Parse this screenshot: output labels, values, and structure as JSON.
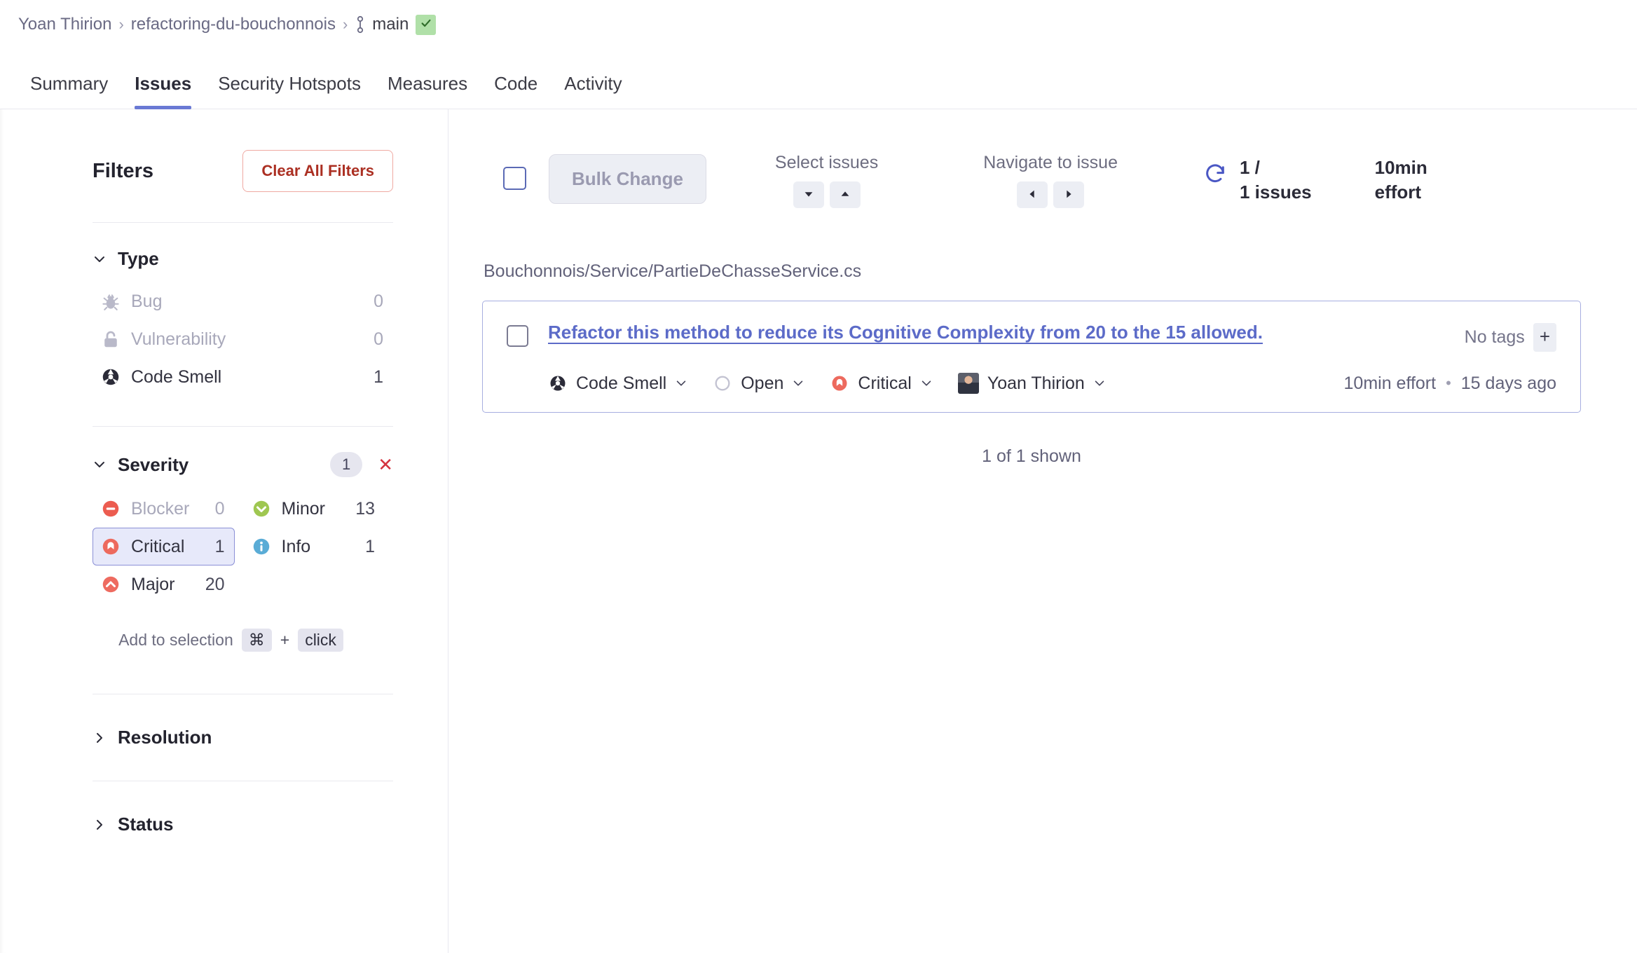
{
  "breadcrumb": {
    "org": "Yoan Thirion",
    "project": "refactoring-du-bouchonnois",
    "branch": "main",
    "separator": "›",
    "branch_icon": "branch-icon",
    "status_icon": "check-icon"
  },
  "tabs": [
    {
      "label": "Summary",
      "active": false
    },
    {
      "label": "Issues",
      "active": true
    },
    {
      "label": "Security Hotspots",
      "active": false
    },
    {
      "label": "Measures",
      "active": false
    },
    {
      "label": "Code",
      "active": false
    },
    {
      "label": "Activity",
      "active": false
    }
  ],
  "sidebar": {
    "title": "Filters",
    "clear_all_label": "Clear All Filters",
    "facets": [
      {
        "name": "type",
        "title": "Type",
        "expanded": true,
        "items": [
          {
            "label": "Bug",
            "value": "0",
            "icon": "bug-icon",
            "muted": true,
            "selected": false
          },
          {
            "label": "Vulnerability",
            "value": "0",
            "icon": "vulnerability-icon",
            "muted": true,
            "selected": false
          },
          {
            "label": "Code Smell",
            "value": "1",
            "icon": "code-smell-icon",
            "muted": false,
            "selected": false
          }
        ]
      },
      {
        "name": "severity",
        "title": "Severity",
        "expanded": true,
        "count_pill": "1",
        "clear_label": "✕",
        "items_left": [
          {
            "label": "Blocker",
            "value": "0",
            "icon": "blocker-icon",
            "muted": true,
            "selected": false
          },
          {
            "label": "Critical",
            "value": "1",
            "icon": "critical-icon",
            "muted": false,
            "selected": true
          },
          {
            "label": "Major",
            "value": "20",
            "icon": "major-icon",
            "muted": false,
            "selected": false
          }
        ],
        "items_right": [
          {
            "label": "Minor",
            "value": "13",
            "icon": "minor-icon",
            "muted": false,
            "selected": false
          },
          {
            "label": "Info",
            "value": "1",
            "icon": "info-icon",
            "muted": false,
            "selected": false
          }
        ],
        "hint": {
          "text": "Add to selection",
          "key": "⌘",
          "plus": "+",
          "click": "click"
        }
      },
      {
        "name": "resolution",
        "title": "Resolution",
        "expanded": false
      },
      {
        "name": "status",
        "title": "Status",
        "expanded": false
      }
    ]
  },
  "toolbar": {
    "bulk_change_label": "Bulk Change",
    "select_issues_label": "Select issues",
    "navigate_label": "Navigate to issue",
    "count_line_1": "1 /",
    "count_line_2": "1 issues",
    "effort_line_1": "10min",
    "effort_line_2": "effort",
    "refresh_icon": "refresh-icon",
    "down_icon": "caret-down-icon",
    "up_icon": "caret-up-icon",
    "prev_icon": "caret-left-icon",
    "next_icon": "caret-right-icon"
  },
  "issues": {
    "file_path": "Bouchonnois/Service/PartieDeChasseService.cs",
    "shown_text": "1 of 1 shown",
    "item": {
      "title": "Refactor this method to reduce its Cognitive Complexity from 20 to the 15 allowed.",
      "no_tags_label": "No tags",
      "tag_add_label": "+",
      "type_label": "Code Smell",
      "status_label": "Open",
      "severity_label": "Critical",
      "assignee_label": "Yoan Thirion",
      "effort_label": "10min effort",
      "separator_dot": "•",
      "age_label": "15 days ago"
    }
  },
  "colors": {
    "accent_blue": "#6a79d4",
    "link_blue": "#5c6bc8",
    "danger_red": "#d4333f",
    "clear_filters_red": "#ab2f22",
    "critical_red": "#ed6a5e",
    "major_red": "#ee6b60",
    "blocker_red": "#ec5c50",
    "minor_green": "#9fc751",
    "info_blue": "#5aacd6",
    "selected_bg": "#e7e9fa",
    "branch_ok_green": "#b0e0a8"
  }
}
